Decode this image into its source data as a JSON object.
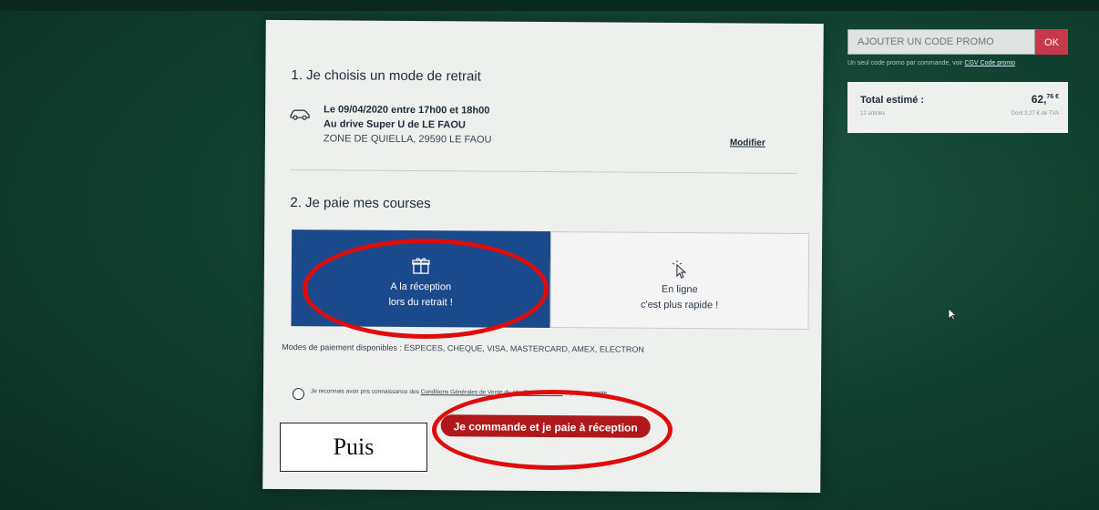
{
  "step1": {
    "title": "1. Je choisis un mode de retrait",
    "date": "Le 09/04/2020 entre 17h00 et 18h00",
    "store": "Au drive Super U de LE FAOU",
    "address": "ZONE DE QUIELLA, 29590 LE FAOU",
    "modify_label": "Modifier"
  },
  "step2": {
    "title": "2. Je paie mes courses",
    "options": [
      {
        "line1": "A la réception",
        "line2": "lors du retrait !",
        "icon": "gift-box-icon",
        "selected": true
      },
      {
        "line1": "En ligne",
        "line2": "c'est plus rapide !",
        "icon": "pointer-click-icon",
        "selected": false
      }
    ],
    "payment_modes": "Modes de paiement disponibles : ESPECES, CHEQUE, VISA, MASTERCARD, AMEX, ELECTRON",
    "terms_prefix": "Je reconnais avoir pris connaissance des",
    "terms_link": "Conditions Générales de Vente du site CoursesU.com",
    "terms_suffix": "et je les accepte.",
    "cta_label": "Je commande et je paie à réception"
  },
  "promo": {
    "placeholder": "AJOUTER UN CODE PROMO",
    "ok_label": "OK",
    "note": "Un seul code promo par commande, voir",
    "note_link": "CGV Code promo"
  },
  "total": {
    "label": "Total estimé :",
    "count": "12 articles",
    "value_int": "62,",
    "value_dec": "76 €",
    "tva": "Dont 3,27 € de TVA"
  },
  "annotation": {
    "puis": "Puis"
  },
  "colors": {
    "selected_card": "#1b4a8c",
    "cta": "#b0191c",
    "annotation_red": "#e00b0b",
    "promo_ok": "#c7384a"
  }
}
